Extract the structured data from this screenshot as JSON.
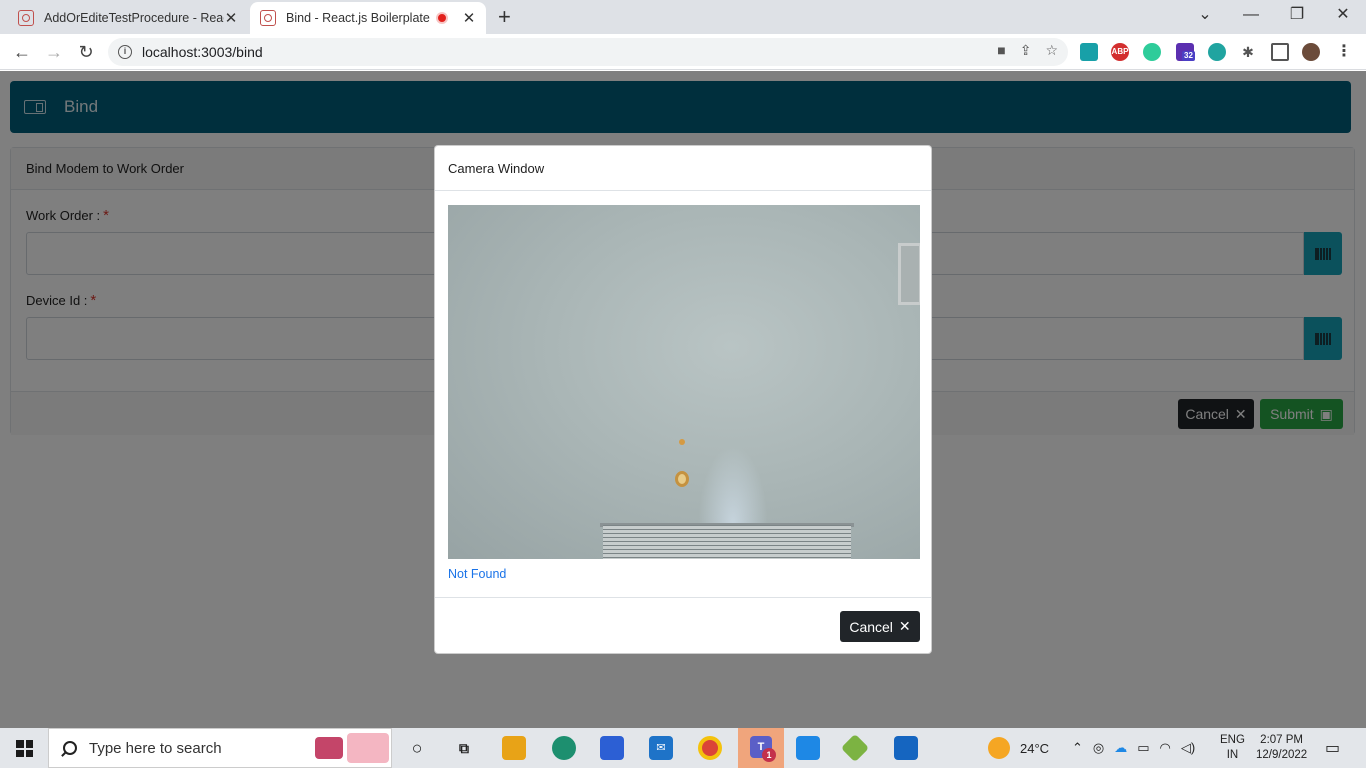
{
  "browser": {
    "tabs": [
      {
        "title": "AddOrEditeTestProcedure - React",
        "active": false
      },
      {
        "title": "Bind - React.js Boilerplate",
        "active": true,
        "recording": true
      }
    ],
    "address": "localhost:3003/bind",
    "extension_badge": "32"
  },
  "app": {
    "header_title": "Bind",
    "card_title": "Bind Modem to Work Order",
    "fields": [
      {
        "label": "Work Order :",
        "required_mark": "*",
        "value": ""
      },
      {
        "label": "Device Id :",
        "required_mark": "*",
        "value": ""
      }
    ],
    "cancel_label": "Cancel",
    "submit_label": "Submit"
  },
  "modal": {
    "title": "Camera Window",
    "status_link": "Not Found",
    "cancel_label": "Cancel"
  },
  "taskbar": {
    "search_placeholder": "Type here to search",
    "temperature": "24°C",
    "lang_line1": "ENG",
    "lang_line2": "IN",
    "time": "2:07 PM",
    "date": "12/9/2022",
    "teams_badge": "1"
  },
  "colors": {
    "appbar": "#005f7a",
    "scan_button": "#17a2b8",
    "required": "#d9342b",
    "link": "#1a73e8"
  }
}
